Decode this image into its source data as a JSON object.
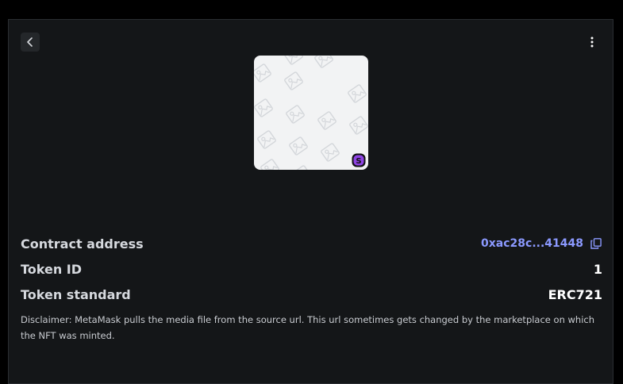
{
  "header": {
    "back_icon": "chevron-left-icon",
    "more_icon": "vertical-dots-icon"
  },
  "media": {
    "placeholder_icon": "image-placeholder-icon",
    "badge_letter": "S",
    "badge_color": "#8f44e4"
  },
  "details": {
    "contract_address_label": "Contract address",
    "contract_address_value": "0xac28c...41448",
    "token_id_label": "Token ID",
    "token_id_value": "1",
    "token_standard_label": "Token standard",
    "token_standard_value": "ERC721"
  },
  "disclaimer": "Disclaimer: MetaMask pulls the media file from the source url. This url sometimes gets changed by the marketplace on which the NFT was minted.",
  "colors": {
    "accent_link": "#8b99ff",
    "background": "#141618"
  }
}
